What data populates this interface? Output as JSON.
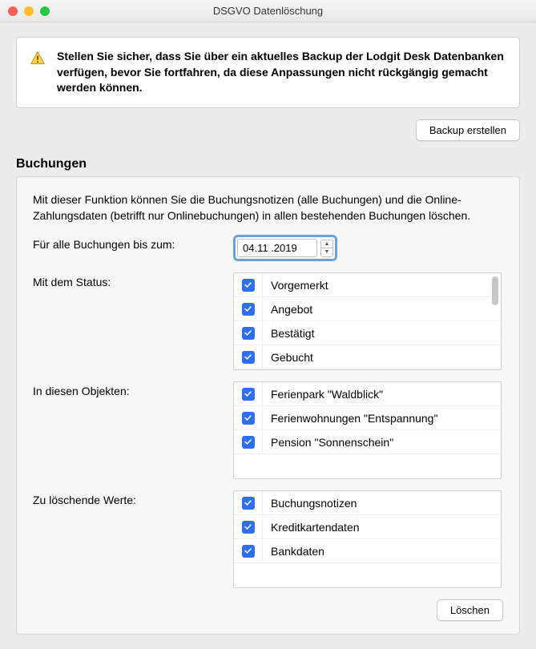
{
  "window": {
    "title": "DSGVO Datenlöschung"
  },
  "warning": {
    "text": "Stellen Sie sicher, dass Sie über ein aktuelles Backup der Lodgit Desk Datenbanken verfügen, bevor Sie fortfahren, da diese Anpassungen nicht rückgängig gemacht werden können."
  },
  "buttons": {
    "backup": "Backup erstellen",
    "delete": "Löschen"
  },
  "section": {
    "title": "Buchungen",
    "description": "Mit dieser Funktion können Sie die Buchungsnotizen (alle Buchungen) und die Online-Zahlungsdaten (betrifft nur Onlinebuchungen) in allen bestehenden Buchungen löschen."
  },
  "labels": {
    "date": "Für alle Buchungen bis zum:",
    "status": "Mit dem Status:",
    "objects": "In diesen Objekten:",
    "values": "Zu löschende Werte:"
  },
  "date": {
    "value": "04.11 .2019"
  },
  "status_items": [
    {
      "label": "Vorgemerkt",
      "checked": true
    },
    {
      "label": "Angebot",
      "checked": true
    },
    {
      "label": "Bestätigt",
      "checked": true
    },
    {
      "label": "Gebucht",
      "checked": true
    }
  ],
  "object_items": [
    {
      "label": "Ferienpark \"Waldblick\"",
      "checked": true
    },
    {
      "label": "Ferienwohnungen \"Entspannung\"",
      "checked": true
    },
    {
      "label": "Pension \"Sonnenschein\"",
      "checked": true
    }
  ],
  "value_items": [
    {
      "label": "Buchungsnotizen",
      "checked": true
    },
    {
      "label": "Kreditkartendaten",
      "checked": true
    },
    {
      "label": "Bankdaten",
      "checked": true
    }
  ]
}
